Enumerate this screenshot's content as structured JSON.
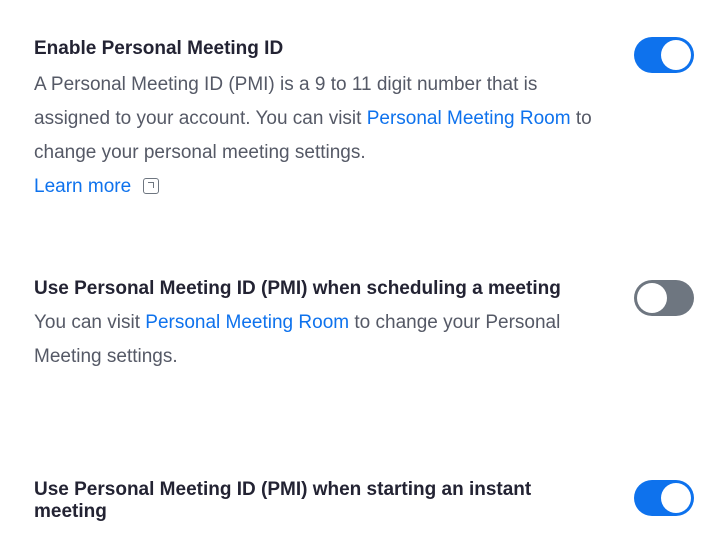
{
  "colors": {
    "accent": "#0e72ed",
    "toggle_off": "#6e7680",
    "title_text": "#232333",
    "body_text": "#555966"
  },
  "settings": [
    {
      "title": "Enable Personal Meeting ID",
      "desc_1": "A Personal Meeting ID (PMI) is a 9 to 11 digit number that is assigned to your account. You can visit ",
      "link_1": "Personal Meeting Room",
      "desc_2": " to change your personal meeting settings.",
      "learn_more": "Learn more",
      "learn_more_icon": "external-link-icon",
      "enabled": true
    },
    {
      "title": "Use Personal Meeting ID (PMI) when scheduling a meeting",
      "desc_1": "You can visit ",
      "link_1": "Personal Meeting Room",
      "desc_2": " to change your Personal Meeting settings.",
      "enabled": false
    },
    {
      "title": "Use Personal Meeting ID (PMI) when starting an instant meeting",
      "enabled": true
    }
  ]
}
